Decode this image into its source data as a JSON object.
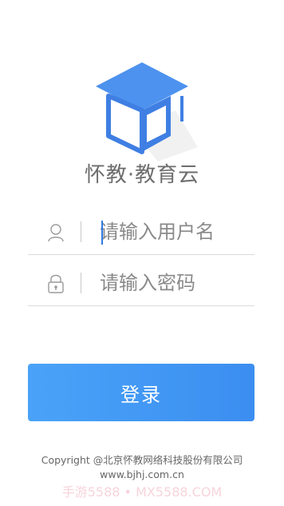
{
  "app": {
    "title": "怀教·教育云"
  },
  "login": {
    "username_placeholder": "请输入用户名",
    "password_placeholder": "请输入密码",
    "login_button": "登录"
  },
  "footer": {
    "copyright": "Copyright @北京怀教网络科技股份有限公司",
    "website": "www.bjhj.com.cn",
    "watermark": "手游5588 • MX5588.COM"
  },
  "colors": {
    "accent": "#3b8ef0",
    "logo_blue": "#3f7fe3",
    "logo_light": "#4d92ee"
  },
  "icons": {
    "user": "user-icon",
    "lock": "lock-icon",
    "logo": "graduation-cap-logo-icon"
  }
}
